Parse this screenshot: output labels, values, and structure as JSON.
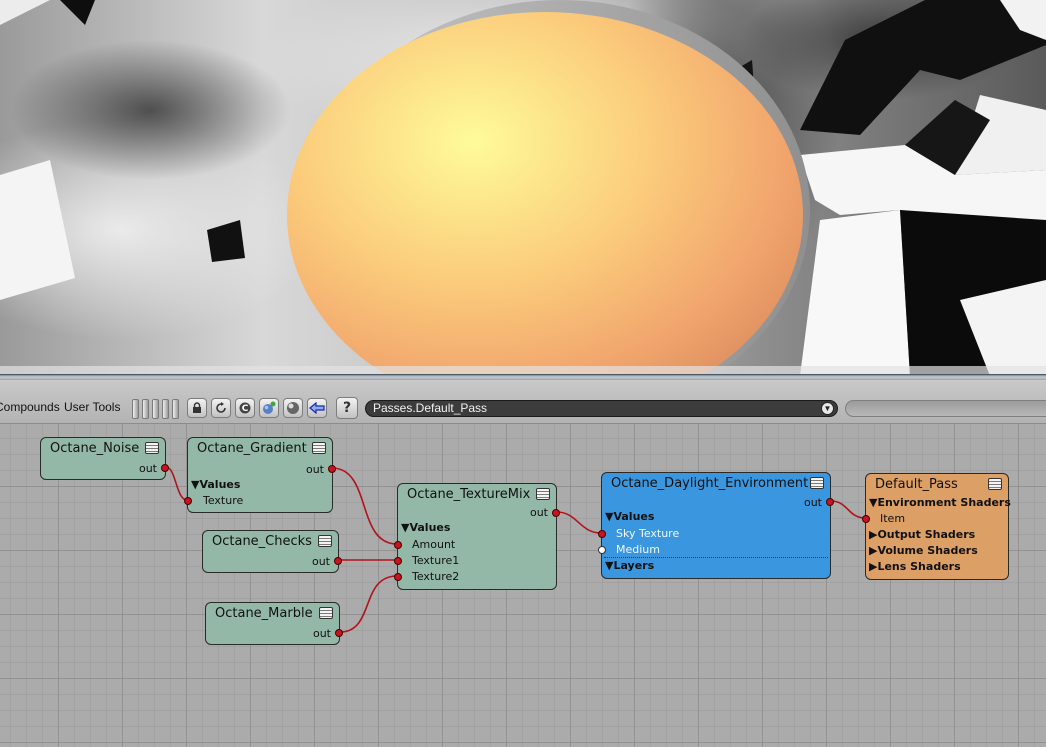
{
  "toolbar": {
    "menu": [
      "Compounds",
      "User Tools"
    ],
    "path": "Passes.Default_Pass",
    "icons": [
      "lock-icon",
      "refresh-icon",
      "compound-c-icon",
      "add-globe-icon",
      "sphere-icon",
      "back-arrow-icon",
      "help-icon"
    ],
    "help_label": "?"
  },
  "nodes": {
    "noise": {
      "title": "Octane_Noise",
      "out": "out"
    },
    "gradient": {
      "title": "Octane_Gradient",
      "out": "out",
      "values": "▼Values",
      "texture": "Texture"
    },
    "checks": {
      "title": "Octane_Checks",
      "out": "out"
    },
    "marble": {
      "title": "Octane_Marble",
      "out": "out"
    },
    "texturemix": {
      "title": "Octane_TextureMix",
      "out": "out",
      "values": "▼Values",
      "amount": "Amount",
      "texture1": "Texture1",
      "texture2": "Texture2"
    },
    "daylight": {
      "title": "Octane_Daylight_Environment",
      "out": "out",
      "values": "▼Values",
      "sky_texture": "Sky Texture",
      "medium": "Medium",
      "layers": "▼Layers"
    },
    "pass": {
      "title": "Default_Pass",
      "env": "▼Environment Shaders",
      "item": "Item",
      "output": "▶Output Shaders",
      "volume": "▶Volume Shaders",
      "lens": "▶Lens Shaders"
    }
  },
  "colors": {
    "node_teal": "#94b8a7",
    "node_blue": "#3a96df",
    "node_orange": "#dc9f66",
    "wire": "#b0141c",
    "graph_bg": "#ababab"
  }
}
